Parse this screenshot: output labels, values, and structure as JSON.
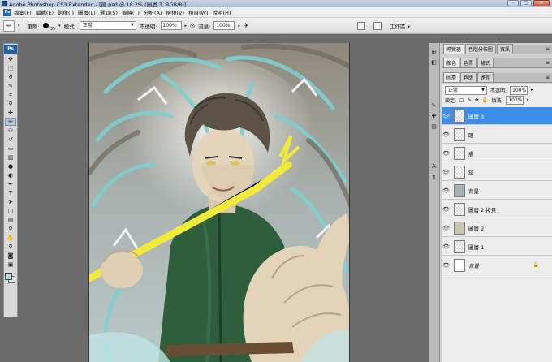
{
  "window": {
    "title": "Adobe Photoshop CS3 Extended - [搶.psd @ 18.2% (圖層 3, RGB/8)]",
    "minimize": "–",
    "maximize": "□",
    "close": "✕"
  },
  "menubar": {
    "logo": "Ps",
    "items": [
      "檔案(F)",
      "編輯(E)",
      "影像(I)",
      "圖層(L)",
      "選取(S)",
      "濾鏡(T)",
      "分析(A)",
      "檢視(V)",
      "視窗(W)",
      "說明(H)"
    ]
  },
  "options": {
    "brush_label": "筆刷:",
    "brush_size": "35",
    "mode_label": "模式:",
    "mode_value": "正常",
    "opacity_label": "不透明:",
    "opacity_value": "100%",
    "flow_label": "流量:",
    "flow_value": "100%",
    "workspace_label": "工作區 ▾"
  },
  "toolbox": {
    "logo": "Ps",
    "tools": [
      {
        "name": "move-tool",
        "glyph": "✥"
      },
      {
        "name": "marquee-tool",
        "glyph": "⬚"
      },
      {
        "name": "lasso-tool",
        "glyph": "ϑ"
      },
      {
        "name": "quick-select-tool",
        "glyph": "✎"
      },
      {
        "name": "crop-tool",
        "glyph": "⌗"
      },
      {
        "name": "eyedropper-tool",
        "glyph": "⚲"
      },
      {
        "name": "healing-brush-tool",
        "glyph": "✚"
      },
      {
        "name": "brush-tool",
        "glyph": "✏"
      },
      {
        "name": "clone-stamp-tool",
        "glyph": "⚇"
      },
      {
        "name": "history-brush-tool",
        "glyph": "↺"
      },
      {
        "name": "eraser-tool",
        "glyph": "▭"
      },
      {
        "name": "gradient-tool",
        "glyph": "▥"
      },
      {
        "name": "blur-tool",
        "glyph": "●"
      },
      {
        "name": "dodge-tool",
        "glyph": "◐"
      },
      {
        "name": "pen-tool",
        "glyph": "✒"
      },
      {
        "name": "type-tool",
        "glyph": "T"
      },
      {
        "name": "path-select-tool",
        "glyph": "➤"
      },
      {
        "name": "shape-tool",
        "glyph": "▢"
      },
      {
        "name": "notes-tool",
        "glyph": "▤"
      },
      {
        "name": "eyedropper2-tool",
        "glyph": "⚲"
      },
      {
        "name": "hand-tool",
        "glyph": "✋"
      },
      {
        "name": "zoom-tool",
        "glyph": "⚲"
      },
      {
        "name": "quick-mask-tool",
        "glyph": "◙"
      },
      {
        "name": "screen-mode-tool",
        "glyph": "▣"
      }
    ],
    "fg_color": "#b9dcdc",
    "bg_color": "#d8e9e8"
  },
  "panels": {
    "group1_tabs": [
      "導覽器",
      "色階分佈圖",
      "資訊"
    ],
    "group2_tabs": [
      "顏色",
      "色票",
      "樣式"
    ],
    "group3_tabs": [
      "圖層",
      "色版",
      "路徑"
    ],
    "blend_mode": "正常",
    "opacity_label": "不透明:",
    "opacity_value": "100%",
    "lock_label": "鎖定:",
    "fill_label": "填滿:",
    "fill_value": "100%",
    "layers": [
      {
        "name": "圖層 3",
        "selected": true
      },
      {
        "name": "眼",
        "selected": false
      },
      {
        "name": "膚",
        "selected": false
      },
      {
        "name": "錶",
        "selected": false
      },
      {
        "name": "背景",
        "selected": false
      },
      {
        "name": "圖層 2 拷貝",
        "selected": false
      },
      {
        "name": "圖層 2",
        "selected": false
      },
      {
        "name": "圖層 1",
        "selected": false
      },
      {
        "name": "背景",
        "selected": false,
        "locked": true
      }
    ]
  }
}
